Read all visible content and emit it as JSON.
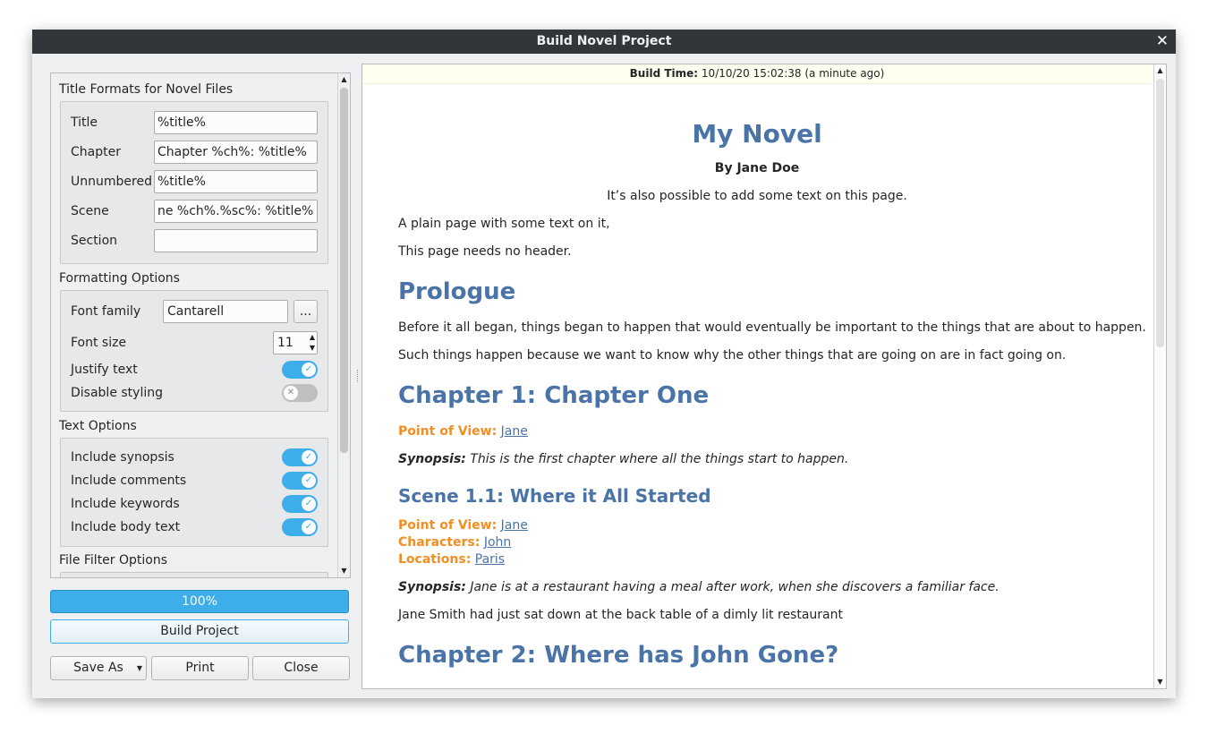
{
  "window": {
    "title": "Build Novel Project"
  },
  "title_formats": {
    "heading": "Title Formats for Novel Files",
    "fields": [
      {
        "label": "Title",
        "value": "%title%"
      },
      {
        "label": "Chapter",
        "value": "Chapter %ch%: %title%"
      },
      {
        "label": "Unnumbered",
        "value": "%title%"
      },
      {
        "label": "Scene",
        "value": "ne %ch%.%sc%: %title%"
      },
      {
        "label": "Section",
        "value": ""
      }
    ]
  },
  "formatting": {
    "heading": "Formatting Options",
    "font_family_label": "Font family",
    "font_family_value": "Cantarell",
    "browse_label": "...",
    "font_size_label": "Font size",
    "font_size_value": "11",
    "justify_label": "Justify text",
    "justify_on": true,
    "disable_styling_label": "Disable styling",
    "disable_styling_on": false
  },
  "text_options": {
    "heading": "Text Options",
    "items": [
      {
        "label": "Include synopsis",
        "on": true
      },
      {
        "label": "Include comments",
        "on": true
      },
      {
        "label": "Include keywords",
        "on": true
      },
      {
        "label": "Include body text",
        "on": true
      }
    ]
  },
  "file_filter": {
    "heading": "File Filter Options"
  },
  "progress": {
    "text": "100%",
    "fraction": 1.0
  },
  "buttons": {
    "build": "Build Project",
    "save_as": "Save As",
    "print": "Print",
    "close": "Close"
  },
  "preview": {
    "build_time_label": "Build Time:",
    "build_time_value": "10/10/20 15:02:38 (a minute ago)",
    "novel_title": "My Novel",
    "byline": "By Jane Doe",
    "title_page_text": "It’s also possible to add some text on this page.",
    "plain_line1": "A plain page with some text on it,",
    "plain_line2": "This page needs no header.",
    "prologue_heading": "Prologue",
    "prologue_p1": "Before it all began, things began to happen that would eventually be important to the things that are about to happen.",
    "prologue_p2": "Such things happen because we want to know why the other things that are going on are in fact going on.",
    "ch1_heading": "Chapter 1: Chapter One",
    "pov_label": "Point of View:",
    "pov_value": "Jane",
    "synopsis_label": "Synopsis:",
    "ch1_synopsis": "This is the first chapter where all the things start to happen.",
    "scene_heading": "Scene 1.1: Where it All Started",
    "scene_pov_value": "Jane",
    "characters_label": "Characters:",
    "characters_value": "John",
    "locations_label": "Locations:",
    "locations_value": "Paris",
    "scene_synopsis": "Jane is at a restaurant having a meal after work, when she discovers a familiar face.",
    "scene_body": "Jane Smith had just sat down at the back table of a dimly lit restaurant",
    "ch2_heading": "Chapter 2: Where has John Gone?"
  }
}
